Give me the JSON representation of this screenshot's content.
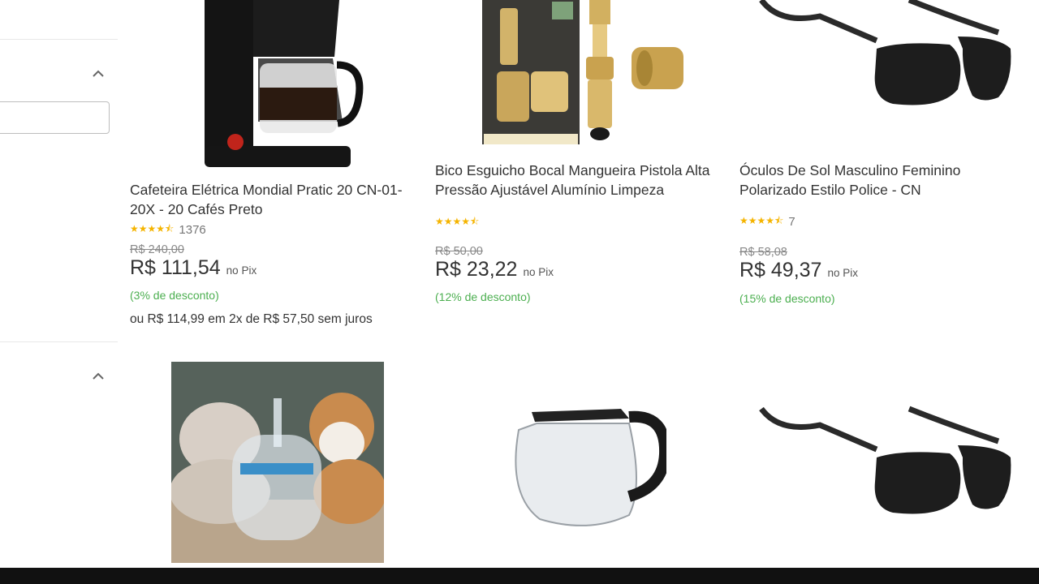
{
  "products": [
    {
      "title": "Cafeteira Elétrica Mondial Pratic 20 CN-01-20X - 20 Cafés Preto",
      "stars": "★★★★⯪",
      "reviews": "1376",
      "old_price": "R$ 240,00",
      "price": "R$ 111,54",
      "pix": "no Pix",
      "discount": "(3% de desconto)",
      "installments": "ou R$ 114,99 em 2x de R$ 57,50 sem juros"
    },
    {
      "title": "Bico Esguicho Bocal Mangueira Pistola Alta Pressão Ajustável Alumínio Limpeza",
      "stars": "★★★★⯪",
      "reviews": "",
      "old_price": "R$ 50,00",
      "price": "R$ 23,22",
      "pix": "no Pix",
      "discount": "(12% de desconto)"
    },
    {
      "title": "Óculos De Sol Masculino Feminino Polarizado Estilo Police - CN",
      "stars": "★★★★⯪",
      "reviews": "7",
      "old_price": "R$ 58,08",
      "price": "R$ 49,37",
      "pix": "no Pix",
      "discount": "(15% de desconto)"
    }
  ],
  "icons": {
    "coffee_maker": "coffee-maker-image",
    "nozzle": "hose-nozzle-image",
    "sunglasses": "sunglasses-image",
    "pet_fountain": "pet-fountain-image",
    "carafe": "glass-carafe-image"
  },
  "colors": {
    "discount": "#4caf50",
    "stars": "#f5b400",
    "text": "#333333"
  }
}
